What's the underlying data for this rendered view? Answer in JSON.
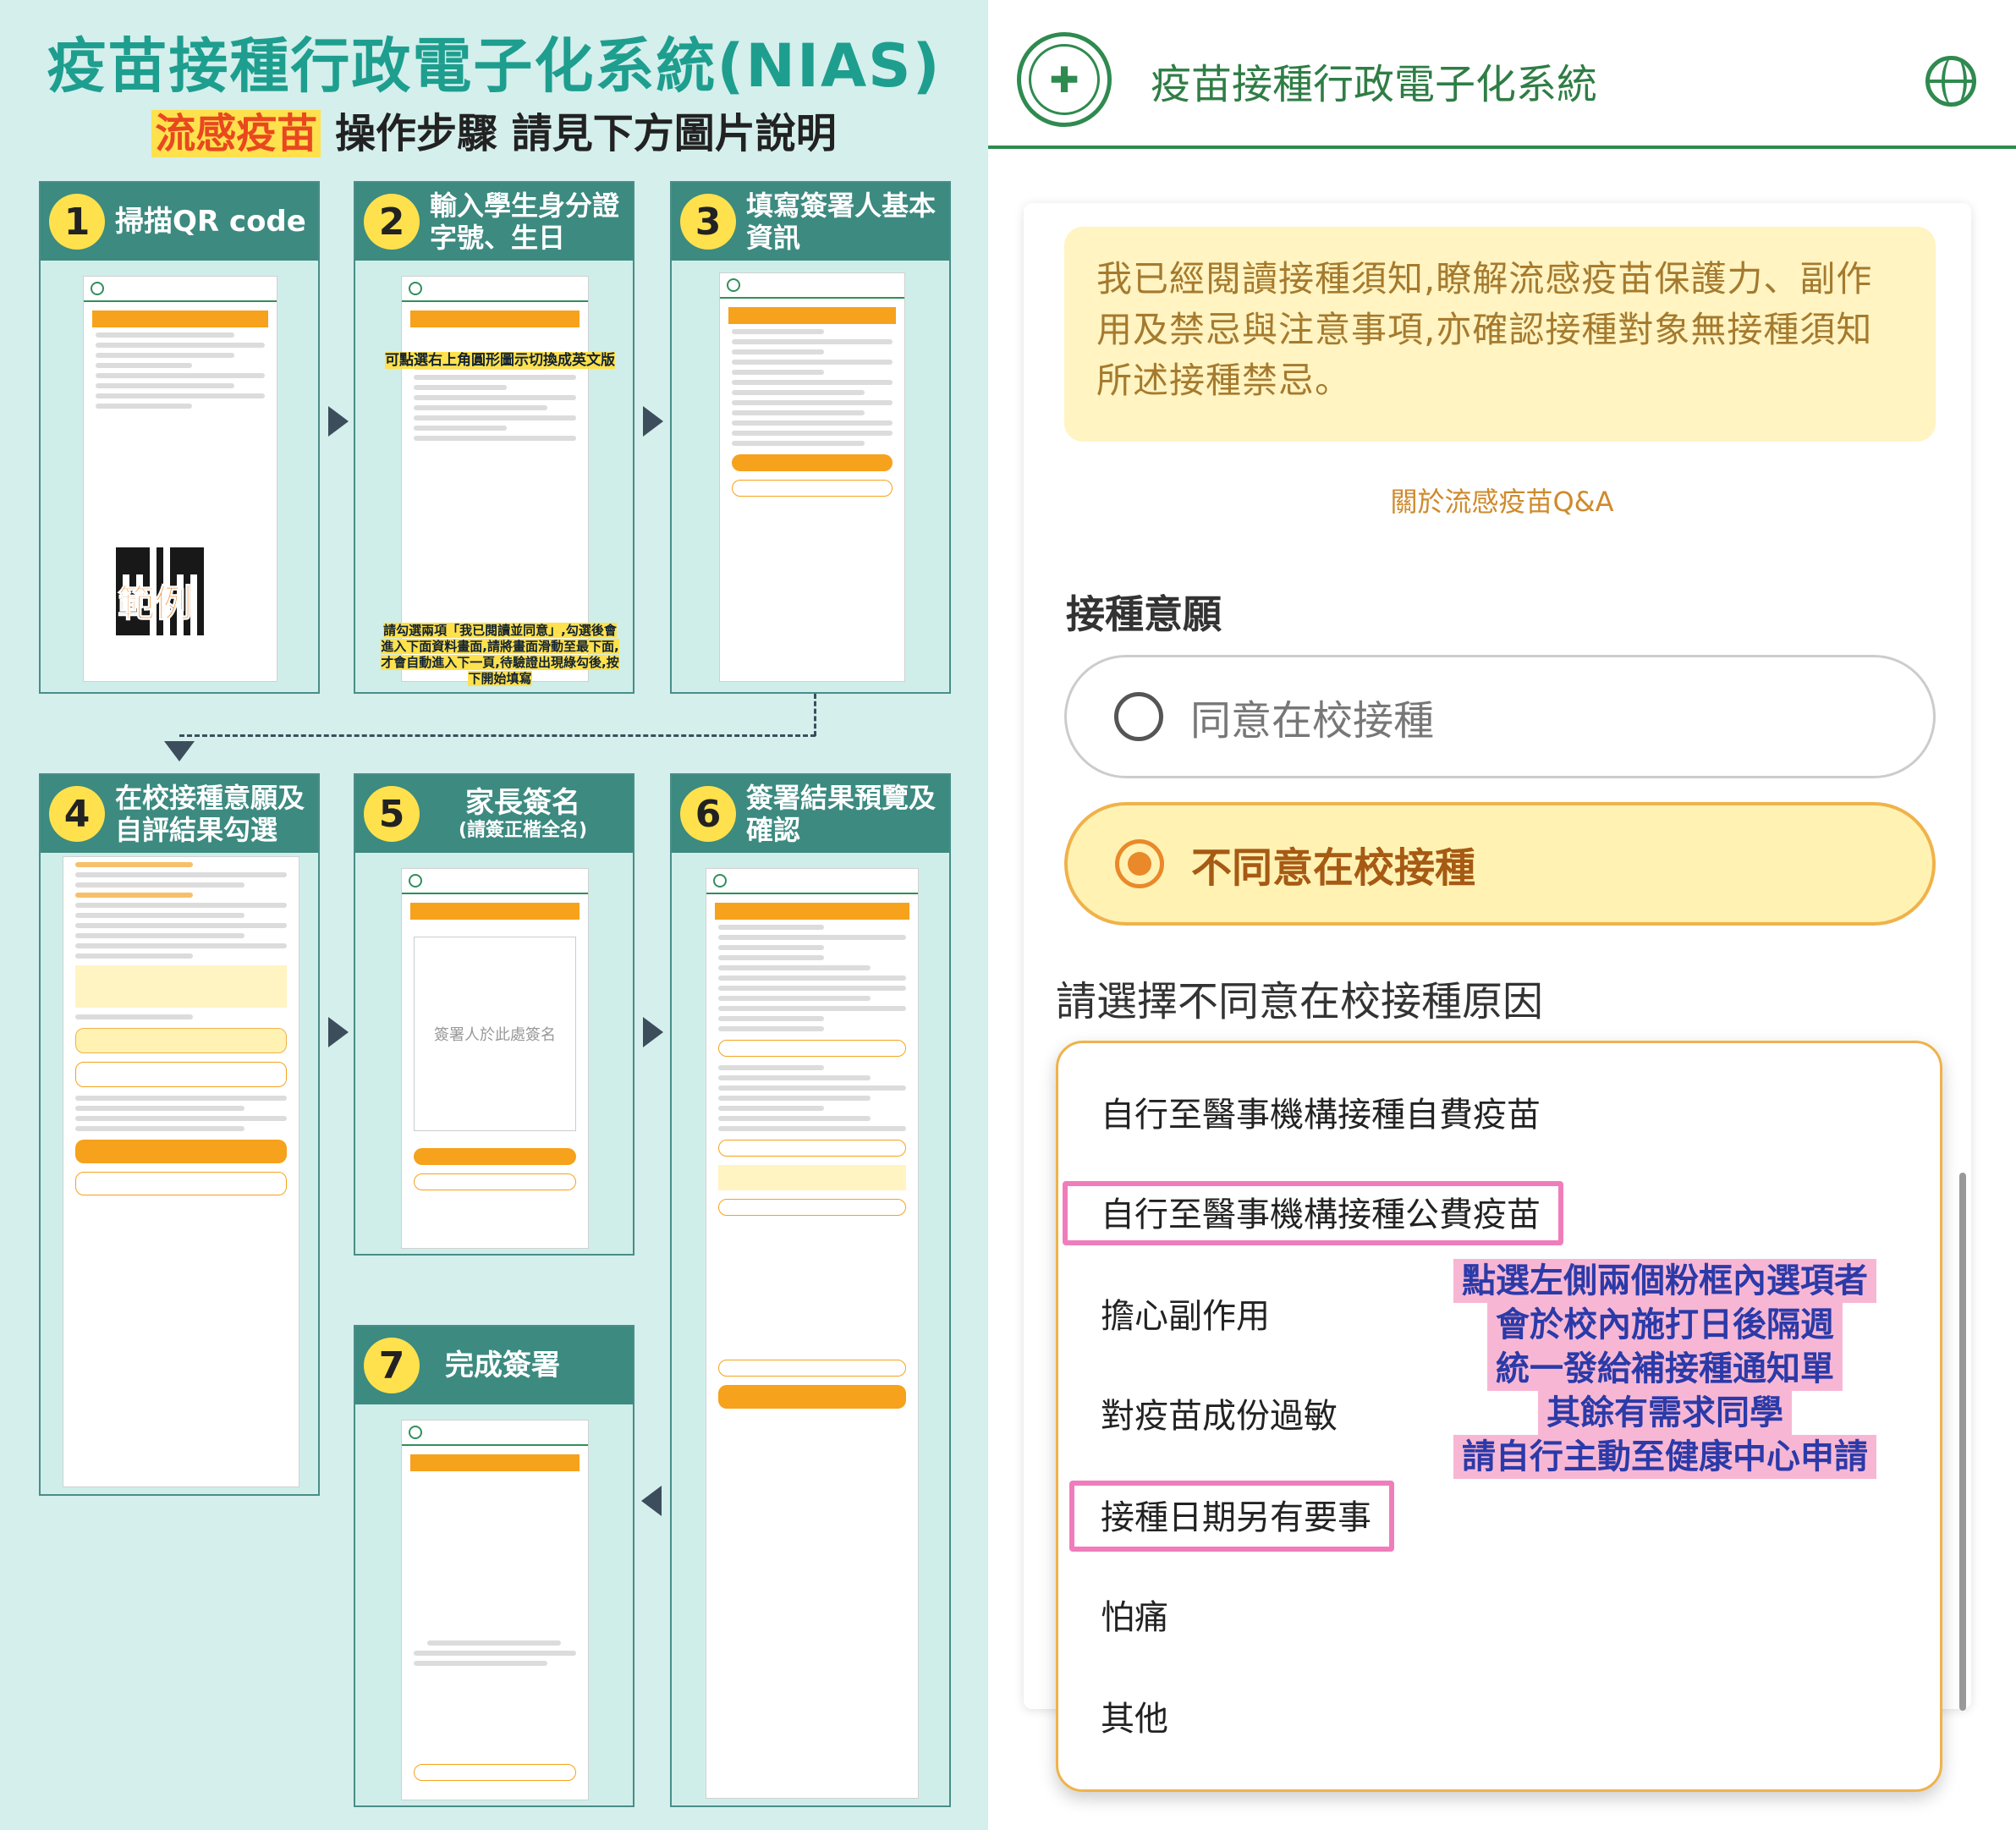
{
  "poster": {
    "title": "疫苗接種行政電子化系統(NIAS)",
    "subtitle_highlight": "流感疫苗",
    "subtitle_rest": "操作步驟 請見下方圖片說明",
    "qr_sample_label": "範例",
    "steps": [
      {
        "num": "1",
        "title": "掃描QR code",
        "note": ""
      },
      {
        "num": "2",
        "title": "輸入學生身分證字號、生日",
        "note": ""
      },
      {
        "num": "3",
        "title": "填寫簽署人基本資訊",
        "note": ""
      },
      {
        "num": "4",
        "title": "在校接種意願及自評結果勾選",
        "note": ""
      },
      {
        "num": "5",
        "title": "家長簽名",
        "note": "(請簽正楷全名)"
      },
      {
        "num": "6",
        "title": "簽署結果預覽及確認",
        "note": ""
      },
      {
        "num": "7",
        "title": "完成簽署",
        "note": ""
      }
    ],
    "step2_note_top": "可點選右上角圓形圖示切換成英文版",
    "step2_note_bottom": "請勾選兩項「我已閱讀並同意」,勾選後會進入下面資料畫面,請將畫面滑動至最下面,才會自動進入下一頁,待驗證出現綠勾後,按下開始填寫",
    "step5_sign_hint": "簽署人於此處簽名"
  },
  "app": {
    "title": "疫苗接種行政電子化系統",
    "logo_icon": "vaccine-logo-icon",
    "lang_icon": "globe-icon",
    "notice": "我已經閱讀接種須知,瞭解流感疫苗保護力、副作用及禁忌與注意事項,亦確認接種對象無接種須知所述接種禁忌。",
    "qa_link": "關於流感疫苗Q&A",
    "consent_label": "接種意願",
    "option_agree": "同意在校接種",
    "option_disagree": "不同意在校接種",
    "selected": "不同意在校接種",
    "reason_label": "請選擇不同意在校接種原因",
    "reasons": [
      "自行至醫事機構接種自費疫苗",
      "自行至醫事機構接種公費疫苗",
      "擔心副作用",
      "對疫苗成份過敏",
      "接種日期另有要事",
      "怕痛",
      "其他"
    ],
    "pink_note": [
      "點選左側兩個粉框內選項者",
      "會於校內施打日後隔週",
      "統一發給補接種通知單",
      "其餘有需求同學",
      "請自行主動至健康中心申請"
    ],
    "colors": {
      "brand_green": "#2f8a4f",
      "accent_orange": "#f0b24a",
      "notice_bg": "#fff4c2",
      "pink": "#f07dbb"
    }
  }
}
